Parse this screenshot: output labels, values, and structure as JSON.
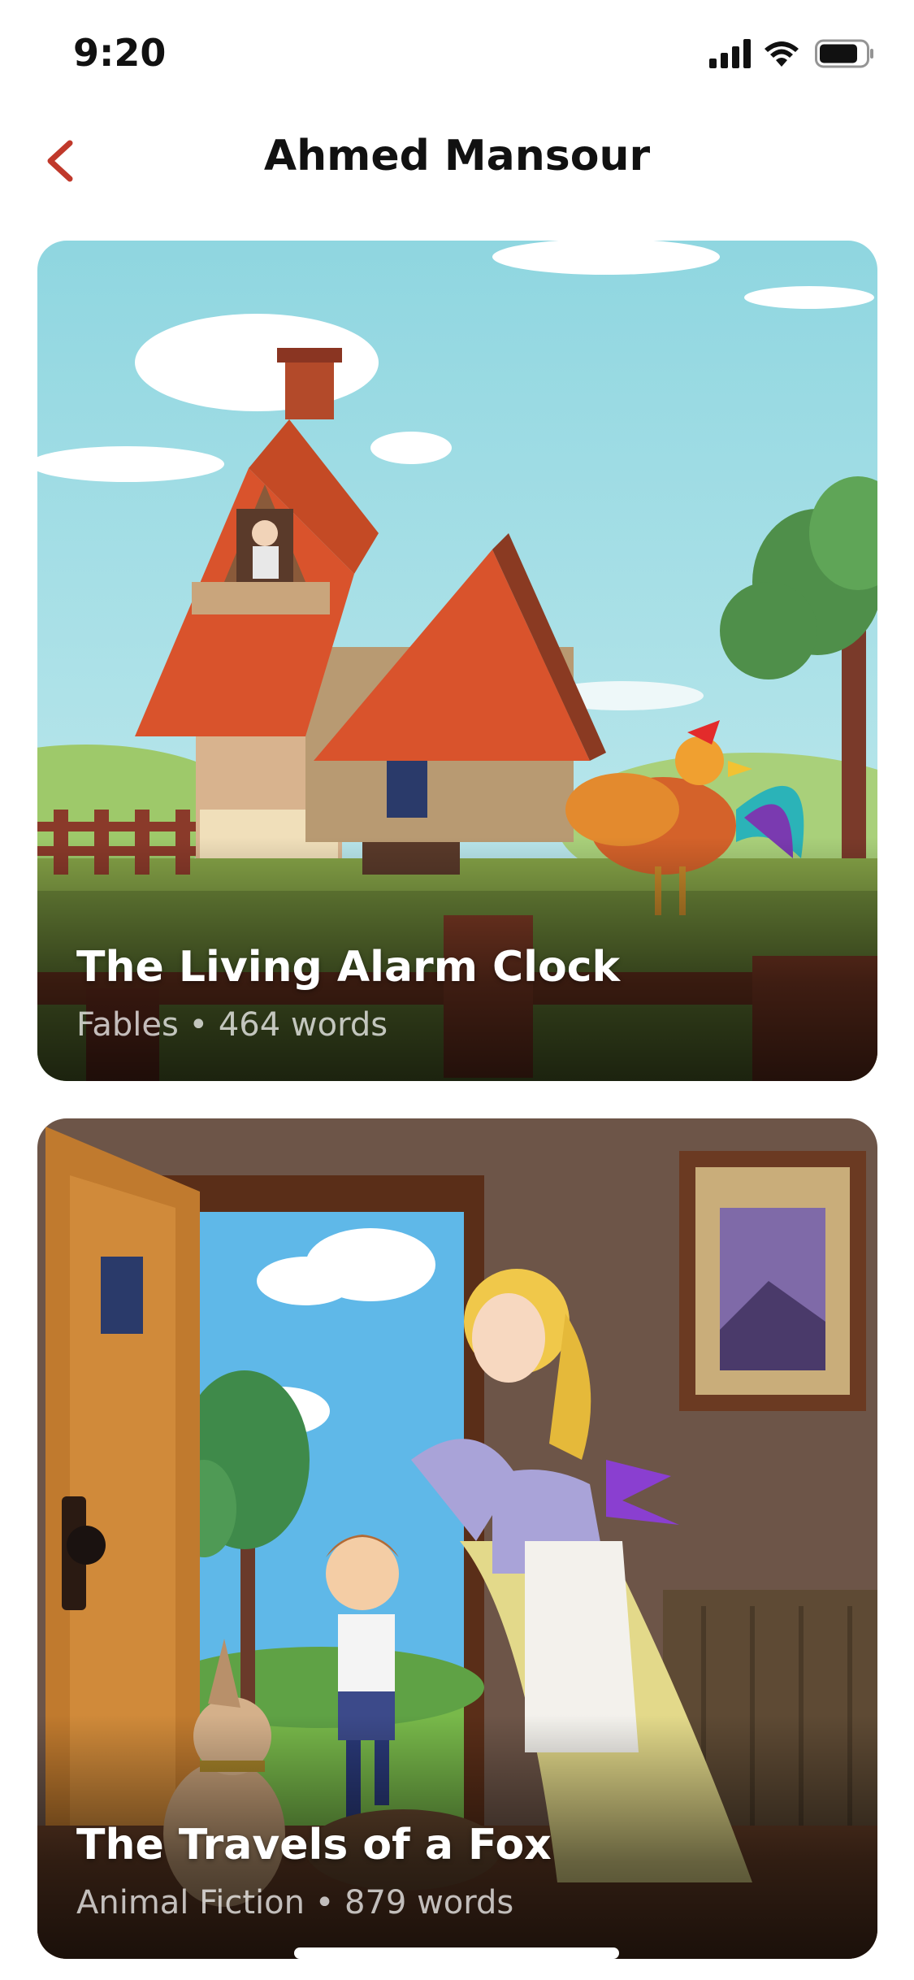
{
  "status": {
    "time": "9:20"
  },
  "header": {
    "title": "Ahmed Mansour",
    "accent": "#c0392b"
  },
  "stories": [
    {
      "title": "The Living Alarm Clock",
      "category": "Fables",
      "separator": "•",
      "words": "464 words"
    },
    {
      "title": "The Travels of a Fox",
      "category": "Animal Fiction",
      "separator": "•",
      "words": "879 words"
    }
  ]
}
